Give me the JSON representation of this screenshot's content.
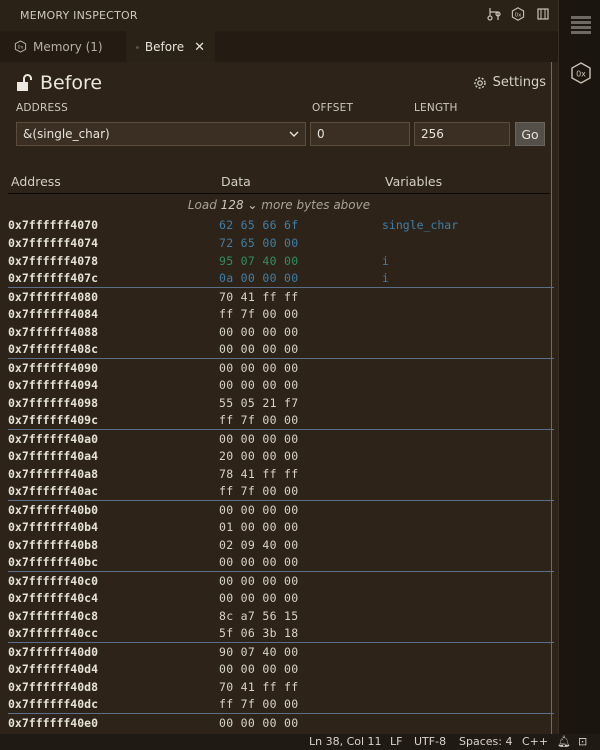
{
  "panel": {
    "title": "MEMORY INSPECTOR"
  },
  "tabs": [
    {
      "label": "Memory (1)",
      "active": false
    },
    {
      "label": "Before",
      "active": true
    }
  ],
  "view": {
    "title": "Before",
    "settings_label": "Settings"
  },
  "form": {
    "address_label": "ADDRESS",
    "address_value": "&(single_char)",
    "offset_label": "OFFSET",
    "offset_value": "0",
    "length_label": "LENGTH",
    "length_value": "256",
    "go_label": "Go"
  },
  "columns": {
    "address": "Address",
    "data": "Data",
    "variables": "Variables"
  },
  "load_more": {
    "prefix": "Load",
    "amount": "128",
    "suffix": "more bytes above"
  },
  "rows": [
    {
      "address": "0x7ffffff4070",
      "data": "62 65 66 6f",
      "variable": "single_char",
      "highlight": "blue"
    },
    {
      "address": "0x7ffffff4074",
      "data": "72 65 00 00",
      "variable": "",
      "highlight": "blue"
    },
    {
      "address": "0x7ffffff4078",
      "data": "95 07 40 00",
      "variable": "i",
      "highlight": "green"
    },
    {
      "address": "0x7ffffff407c",
      "data": "0a 00 00 00",
      "variable": "i",
      "highlight": "blue"
    },
    {
      "address": "0x7ffffff4080",
      "data": "70 41 ff ff",
      "variable": "",
      "highlight": ""
    },
    {
      "address": "0x7ffffff4084",
      "data": "ff 7f 00 00",
      "variable": "",
      "highlight": ""
    },
    {
      "address": "0x7ffffff4088",
      "data": "00 00 00 00",
      "variable": "",
      "highlight": ""
    },
    {
      "address": "0x7ffffff408c",
      "data": "00 00 00 00",
      "variable": "",
      "highlight": ""
    },
    {
      "address": "0x7ffffff4090",
      "data": "00 00 00 00",
      "variable": "",
      "highlight": ""
    },
    {
      "address": "0x7ffffff4094",
      "data": "00 00 00 00",
      "variable": "",
      "highlight": ""
    },
    {
      "address": "0x7ffffff4098",
      "data": "55 05 21 f7",
      "variable": "",
      "highlight": ""
    },
    {
      "address": "0x7ffffff409c",
      "data": "ff 7f 00 00",
      "variable": "",
      "highlight": ""
    },
    {
      "address": "0x7ffffff40a0",
      "data": "00 00 00 00",
      "variable": "",
      "highlight": ""
    },
    {
      "address": "0x7ffffff40a4",
      "data": "20 00 00 00",
      "variable": "",
      "highlight": ""
    },
    {
      "address": "0x7ffffff40a8",
      "data": "78 41 ff ff",
      "variable": "",
      "highlight": ""
    },
    {
      "address": "0x7ffffff40ac",
      "data": "ff 7f 00 00",
      "variable": "",
      "highlight": ""
    },
    {
      "address": "0x7ffffff40b0",
      "data": "00 00 00 00",
      "variable": "",
      "highlight": ""
    },
    {
      "address": "0x7ffffff40b4",
      "data": "01 00 00 00",
      "variable": "",
      "highlight": ""
    },
    {
      "address": "0x7ffffff40b8",
      "data": "02 09 40 00",
      "variable": "",
      "highlight": ""
    },
    {
      "address": "0x7ffffff40bc",
      "data": "00 00 00 00",
      "variable": "",
      "highlight": ""
    },
    {
      "address": "0x7ffffff40c0",
      "data": "00 00 00 00",
      "variable": "",
      "highlight": ""
    },
    {
      "address": "0x7ffffff40c4",
      "data": "00 00 00 00",
      "variable": "",
      "highlight": ""
    },
    {
      "address": "0x7ffffff40c8",
      "data": "8c a7 56 15",
      "variable": "",
      "highlight": ""
    },
    {
      "address": "0x7ffffff40cc",
      "data": "5f 06 3b 18",
      "variable": "",
      "highlight": ""
    },
    {
      "address": "0x7ffffff40d0",
      "data": "90 07 40 00",
      "variable": "",
      "highlight": ""
    },
    {
      "address": "0x7ffffff40d4",
      "data": "00 00 00 00",
      "variable": "",
      "highlight": ""
    },
    {
      "address": "0x7ffffff40d8",
      "data": "70 41 ff ff",
      "variable": "",
      "highlight": ""
    },
    {
      "address": "0x7ffffff40dc",
      "data": "ff 7f 00 00",
      "variable": "",
      "highlight": ""
    },
    {
      "address": "0x7ffffff40e0",
      "data": "00 00 00 00",
      "variable": "",
      "highlight": ""
    }
  ],
  "status": {
    "position": "Ln 38, Col 11",
    "eol": "LF",
    "encoding": "UTF-8",
    "indent": "Spaces: 4",
    "language": "C++"
  }
}
